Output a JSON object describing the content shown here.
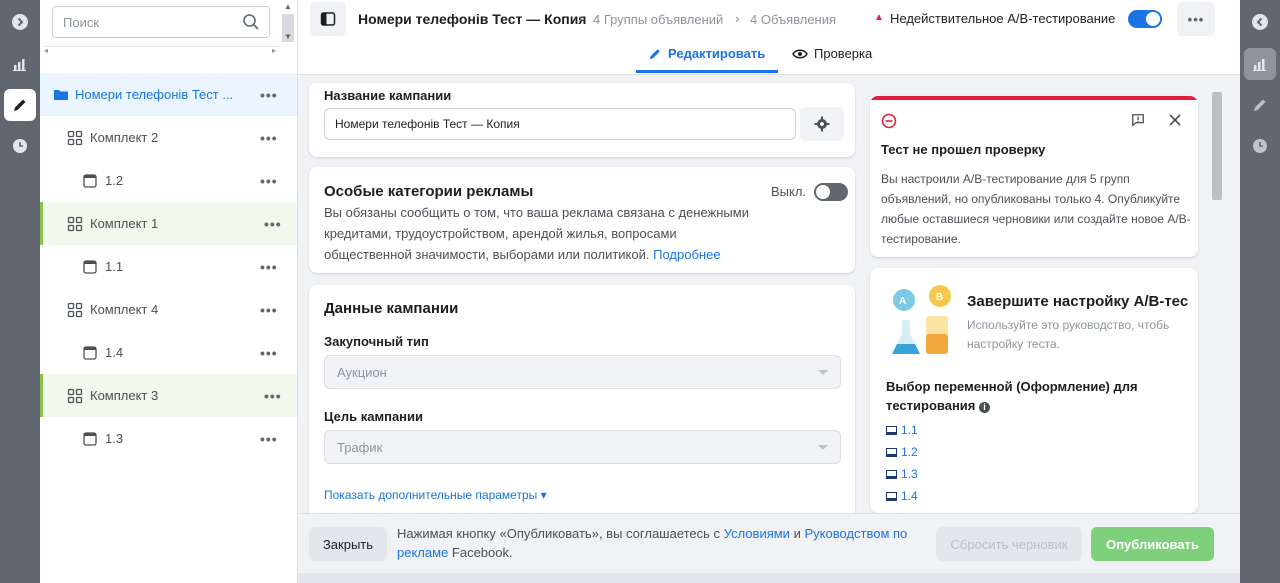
{
  "tree": {
    "search_placeholder": "Поиск",
    "items": [
      {
        "label": "Номери телефонів Тест ..."
      },
      {
        "label": "Комплект 2"
      },
      {
        "label": "1.2"
      },
      {
        "label": "Комплект 1"
      },
      {
        "label": "1.1"
      },
      {
        "label": "Комплект 4"
      },
      {
        "label": "1.4"
      },
      {
        "label": "Комплект 3"
      },
      {
        "label": "1.3"
      }
    ],
    "more_label": "•••"
  },
  "header": {
    "title": "Номери телефонів Тест — Копия",
    "crumb_groups": "4 Группы объявлений",
    "crumb_ads": "4 Объявления",
    "status": "Недействительное A/B-тестирование",
    "more_label": "•••"
  },
  "tabs": [
    {
      "label": "Редактировать"
    },
    {
      "label": "Проверка"
    }
  ],
  "campaign_name": {
    "label": "Название кампании",
    "value": "Номери телефонів Тест — Копия"
  },
  "special": {
    "title": "Особые категории рекламы",
    "toggle_label": "Выкл.",
    "text": "Вы обязаны сообщить о том, что ваша реклама связана с денежными кредитами, трудоустройством, арендой жилья, вопросами общественной значимости, выборами или политикой.",
    "link": "Подробнее"
  },
  "campaign_data": {
    "title": "Данные кампании",
    "buy_type_label": "Закупочный тип",
    "buy_type_value": "Аукцион",
    "objective_label": "Цель кампании",
    "objective_value": "Трафик",
    "more_params": "Показать дополнительные параметры ▾"
  },
  "alert": {
    "title": "Тест не прошел проверку",
    "text": "Вы настроили A/B-тестирование для 5 групп объявлений, но опубликованы только 4. Опубликуйте любые оставшиеся черновики или создайте новое A/B-тестирование."
  },
  "guide": {
    "title": "Завершите настройку A/B-тес",
    "text": "Используйте это руководство, чтобь настройку теста.",
    "variable_title": "Выбор переменной (Оформление) для тестирования",
    "items": [
      "1.1",
      "1.2",
      "1.3",
      "1.4"
    ]
  },
  "footer": {
    "close": "Закрыть",
    "text_pre": "Нажимая кнопку «Опубликовать», вы соглашаетесь с",
    "link_terms": "Условиями",
    "and": "и",
    "link_guide": "Руководством по рекламе",
    "text_post": "Facebook.",
    "reset": "Сбросить черновик",
    "publish": "Опубликовать"
  },
  "colors": {
    "accent": "#1b74e4",
    "error": "#e41e3f",
    "publish": "#7ed07c"
  }
}
